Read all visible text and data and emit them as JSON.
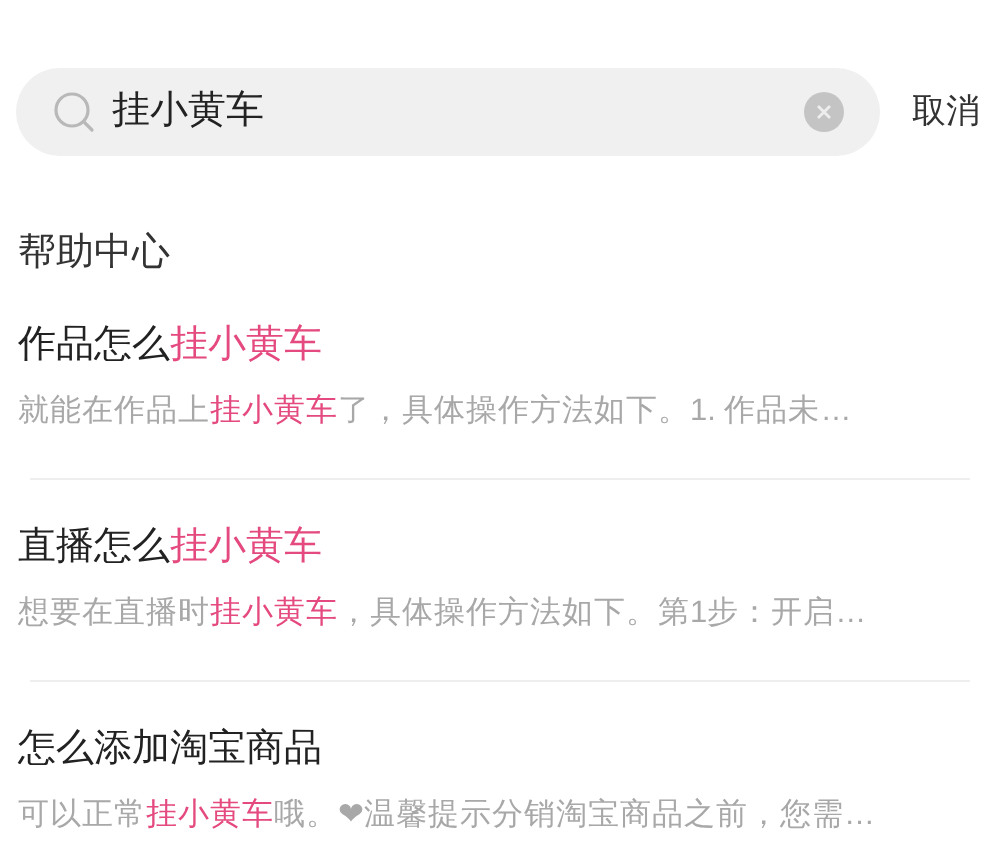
{
  "search": {
    "value": "挂小黄车",
    "cancel": "取消"
  },
  "section_title": "帮助中心",
  "results": [
    {
      "title": [
        {
          "text": "作品怎么",
          "highlight": false
        },
        {
          "text": "挂小黄车",
          "highlight": true
        }
      ],
      "snippet": [
        {
          "text": "就能在作品上",
          "highlight": false
        },
        {
          "text": "挂小黄车",
          "highlight": true
        },
        {
          "text": "了，具体操作方法如下。1. 作品未…",
          "highlight": false
        }
      ]
    },
    {
      "title": [
        {
          "text": "直播怎么",
          "highlight": false
        },
        {
          "text": "挂小黄车",
          "highlight": true
        }
      ],
      "snippet": [
        {
          "text": "想要在直播时",
          "highlight": false
        },
        {
          "text": "挂小黄车",
          "highlight": true
        },
        {
          "text": "，具体操作方法如下。第1步：开启…",
          "highlight": false
        }
      ]
    },
    {
      "title": [
        {
          "text": "怎么添加淘宝商品",
          "highlight": false
        }
      ],
      "snippet": [
        {
          "text": "可以正常",
          "highlight": false
        },
        {
          "text": "挂小黄车",
          "highlight": true
        },
        {
          "text": "哦。❤温馨提示分销淘宝商品之前，您需…",
          "highlight": false
        }
      ]
    }
  ]
}
